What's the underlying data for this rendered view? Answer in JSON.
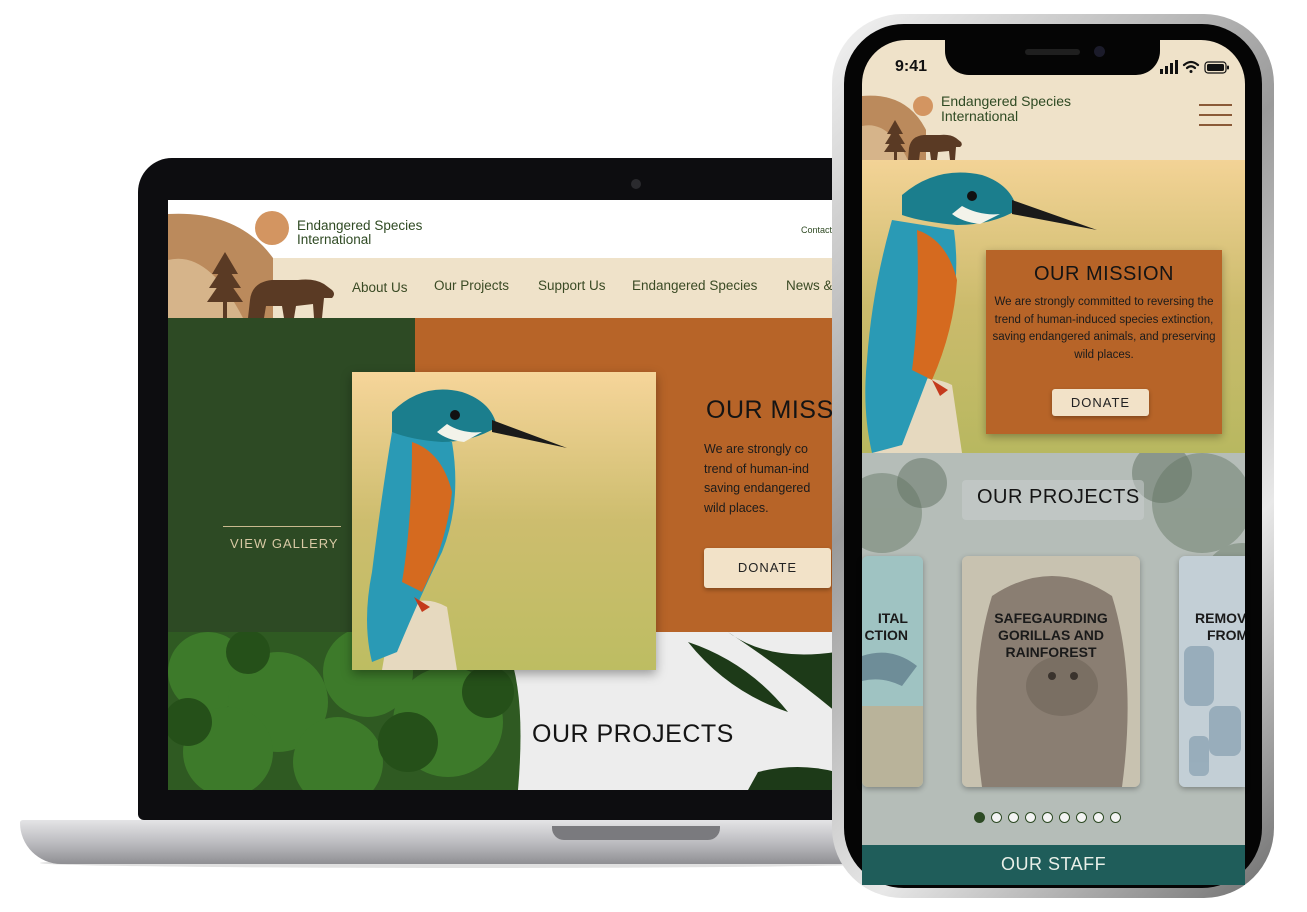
{
  "brand": {
    "line1": "Endangered Species",
    "line2": "International"
  },
  "desktop": {
    "contact": "Contact",
    "nav": [
      "About Us",
      "Our Projects",
      "Support Us",
      "Endangered Species",
      "News &"
    ],
    "view_gallery": "VIEW GALLERY",
    "mission_title": "OUR MISSI",
    "mission_lines": [
      "We are strongly co",
      "trend of human-ind",
      "saving endangered",
      "wild places."
    ],
    "donate": "DONATE",
    "projects_title": "OUR PROJECTS"
  },
  "mobile": {
    "time": "9:41",
    "mission_title": "OUR MISSION",
    "mission_text": "We are strongly committed to reversing the trend of human-induced species extinction, saving endangered animals, and preserving wild places.",
    "donate": "DONATE",
    "projects_title": "OUR PROJECTS",
    "cards": [
      {
        "line1": "ITAL",
        "line2": "CTION"
      },
      {
        "line1": "SAFEGAURDING",
        "line2": "GORILLAS AND",
        "line3": "RAINFOREST"
      },
      {
        "line1": "REMOV",
        "line2": "FROM"
      }
    ],
    "dots_total": 9,
    "dots_active": 0,
    "staff_title": "OUR STAFF"
  },
  "colors": {
    "forest_green": "#2d4a24",
    "rust_orange": "#b76428",
    "cream": "#efe2c9",
    "teal": "#1f5d5a"
  },
  "icons": [
    "sun-icon",
    "tree-icon",
    "bear-icon",
    "hamburger-menu-icon",
    "signal-icon",
    "wifi-icon",
    "battery-icon"
  ]
}
